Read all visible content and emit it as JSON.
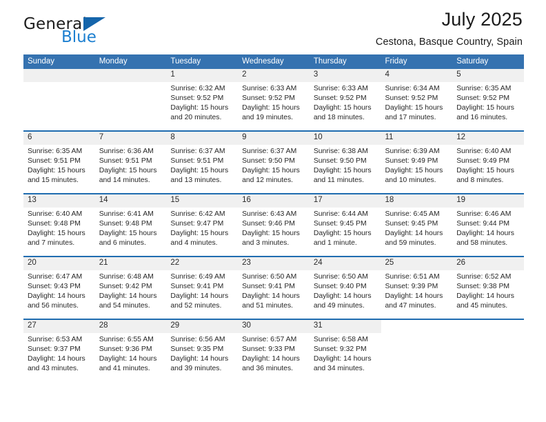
{
  "brand": {
    "name_part1": "General",
    "name_part2": "Blue",
    "logo_icon": "triangle-flag-icon",
    "accent_color": "#1565ab",
    "blue_text_color": "#1c7fd0"
  },
  "header": {
    "month_title": "July 2025",
    "location": "Cestona, Basque Country, Spain"
  },
  "theme": {
    "header_blue": "#3572b0",
    "separator_blue": "#1f6cb0",
    "date_band_gray": "#f0f0f0"
  },
  "calendar": {
    "weekday_headers": [
      "Sunday",
      "Monday",
      "Tuesday",
      "Wednesday",
      "Thursday",
      "Friday",
      "Saturday"
    ],
    "weeks": [
      [
        {
          "day": "",
          "lines": []
        },
        {
          "day": "",
          "lines": []
        },
        {
          "day": "1",
          "lines": [
            "Sunrise: 6:32 AM",
            "Sunset: 9:52 PM",
            "Daylight: 15 hours",
            "and 20 minutes."
          ]
        },
        {
          "day": "2",
          "lines": [
            "Sunrise: 6:33 AM",
            "Sunset: 9:52 PM",
            "Daylight: 15 hours",
            "and 19 minutes."
          ]
        },
        {
          "day": "3",
          "lines": [
            "Sunrise: 6:33 AM",
            "Sunset: 9:52 PM",
            "Daylight: 15 hours",
            "and 18 minutes."
          ]
        },
        {
          "day": "4",
          "lines": [
            "Sunrise: 6:34 AM",
            "Sunset: 9:52 PM",
            "Daylight: 15 hours",
            "and 17 minutes."
          ]
        },
        {
          "day": "5",
          "lines": [
            "Sunrise: 6:35 AM",
            "Sunset: 9:52 PM",
            "Daylight: 15 hours",
            "and 16 minutes."
          ]
        }
      ],
      [
        {
          "day": "6",
          "lines": [
            "Sunrise: 6:35 AM",
            "Sunset: 9:51 PM",
            "Daylight: 15 hours",
            "and 15 minutes."
          ]
        },
        {
          "day": "7",
          "lines": [
            "Sunrise: 6:36 AM",
            "Sunset: 9:51 PM",
            "Daylight: 15 hours",
            "and 14 minutes."
          ]
        },
        {
          "day": "8",
          "lines": [
            "Sunrise: 6:37 AM",
            "Sunset: 9:51 PM",
            "Daylight: 15 hours",
            "and 13 minutes."
          ]
        },
        {
          "day": "9",
          "lines": [
            "Sunrise: 6:37 AM",
            "Sunset: 9:50 PM",
            "Daylight: 15 hours",
            "and 12 minutes."
          ]
        },
        {
          "day": "10",
          "lines": [
            "Sunrise: 6:38 AM",
            "Sunset: 9:50 PM",
            "Daylight: 15 hours",
            "and 11 minutes."
          ]
        },
        {
          "day": "11",
          "lines": [
            "Sunrise: 6:39 AM",
            "Sunset: 9:49 PM",
            "Daylight: 15 hours",
            "and 10 minutes."
          ]
        },
        {
          "day": "12",
          "lines": [
            "Sunrise: 6:40 AM",
            "Sunset: 9:49 PM",
            "Daylight: 15 hours",
            "and 8 minutes."
          ]
        }
      ],
      [
        {
          "day": "13",
          "lines": [
            "Sunrise: 6:40 AM",
            "Sunset: 9:48 PM",
            "Daylight: 15 hours",
            "and 7 minutes."
          ]
        },
        {
          "day": "14",
          "lines": [
            "Sunrise: 6:41 AM",
            "Sunset: 9:48 PM",
            "Daylight: 15 hours",
            "and 6 minutes."
          ]
        },
        {
          "day": "15",
          "lines": [
            "Sunrise: 6:42 AM",
            "Sunset: 9:47 PM",
            "Daylight: 15 hours",
            "and 4 minutes."
          ]
        },
        {
          "day": "16",
          "lines": [
            "Sunrise: 6:43 AM",
            "Sunset: 9:46 PM",
            "Daylight: 15 hours",
            "and 3 minutes."
          ]
        },
        {
          "day": "17",
          "lines": [
            "Sunrise: 6:44 AM",
            "Sunset: 9:45 PM",
            "Daylight: 15 hours",
            "and 1 minute."
          ]
        },
        {
          "day": "18",
          "lines": [
            "Sunrise: 6:45 AM",
            "Sunset: 9:45 PM",
            "Daylight: 14 hours",
            "and 59 minutes."
          ]
        },
        {
          "day": "19",
          "lines": [
            "Sunrise: 6:46 AM",
            "Sunset: 9:44 PM",
            "Daylight: 14 hours",
            "and 58 minutes."
          ]
        }
      ],
      [
        {
          "day": "20",
          "lines": [
            "Sunrise: 6:47 AM",
            "Sunset: 9:43 PM",
            "Daylight: 14 hours",
            "and 56 minutes."
          ]
        },
        {
          "day": "21",
          "lines": [
            "Sunrise: 6:48 AM",
            "Sunset: 9:42 PM",
            "Daylight: 14 hours",
            "and 54 minutes."
          ]
        },
        {
          "day": "22",
          "lines": [
            "Sunrise: 6:49 AM",
            "Sunset: 9:41 PM",
            "Daylight: 14 hours",
            "and 52 minutes."
          ]
        },
        {
          "day": "23",
          "lines": [
            "Sunrise: 6:50 AM",
            "Sunset: 9:41 PM",
            "Daylight: 14 hours",
            "and 51 minutes."
          ]
        },
        {
          "day": "24",
          "lines": [
            "Sunrise: 6:50 AM",
            "Sunset: 9:40 PM",
            "Daylight: 14 hours",
            "and 49 minutes."
          ]
        },
        {
          "day": "25",
          "lines": [
            "Sunrise: 6:51 AM",
            "Sunset: 9:39 PM",
            "Daylight: 14 hours",
            "and 47 minutes."
          ]
        },
        {
          "day": "26",
          "lines": [
            "Sunrise: 6:52 AM",
            "Sunset: 9:38 PM",
            "Daylight: 14 hours",
            "and 45 minutes."
          ]
        }
      ],
      [
        {
          "day": "27",
          "lines": [
            "Sunrise: 6:53 AM",
            "Sunset: 9:37 PM",
            "Daylight: 14 hours",
            "and 43 minutes."
          ]
        },
        {
          "day": "28",
          "lines": [
            "Sunrise: 6:55 AM",
            "Sunset: 9:36 PM",
            "Daylight: 14 hours",
            "and 41 minutes."
          ]
        },
        {
          "day": "29",
          "lines": [
            "Sunrise: 6:56 AM",
            "Sunset: 9:35 PM",
            "Daylight: 14 hours",
            "and 39 minutes."
          ]
        },
        {
          "day": "30",
          "lines": [
            "Sunrise: 6:57 AM",
            "Sunset: 9:33 PM",
            "Daylight: 14 hours",
            "and 36 minutes."
          ]
        },
        {
          "day": "31",
          "lines": [
            "Sunrise: 6:58 AM",
            "Sunset: 9:32 PM",
            "Daylight: 14 hours",
            "and 34 minutes."
          ]
        },
        {
          "day": "",
          "lines": []
        },
        {
          "day": "",
          "lines": []
        }
      ]
    ]
  }
}
